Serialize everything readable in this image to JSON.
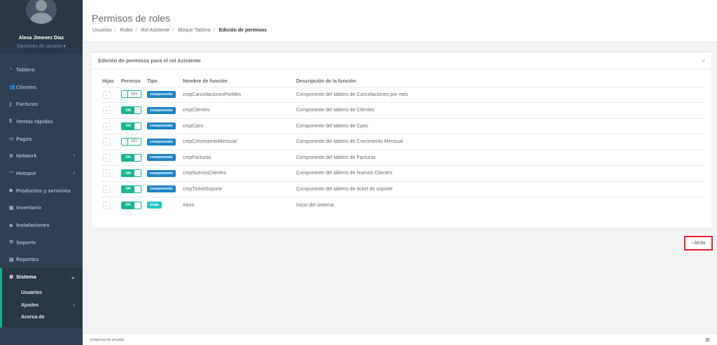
{
  "sidebar": {
    "user_name": "Alexa Jimenez Díaz",
    "user_options": "Opciones de usuario ▾",
    "items": [
      {
        "label": "Tablero",
        "icon": "gauge-icon"
      },
      {
        "label": "Clientes",
        "icon": "users-icon"
      },
      {
        "label": "Facturas",
        "icon": "file-icon"
      },
      {
        "label": "Ventas rápidas",
        "icon": "dollar-icon"
      },
      {
        "label": "Pagos",
        "icon": "money-icon"
      },
      {
        "label": "Network",
        "icon": "network-icon"
      },
      {
        "label": "Hotspot",
        "icon": "wifi-icon"
      },
      {
        "label": "Productos y servicios",
        "icon": "tag-icon"
      },
      {
        "label": "Inventario",
        "icon": "cubes-icon"
      },
      {
        "label": "Instalaciones",
        "icon": "wrench-icon"
      },
      {
        "label": "Soporte",
        "icon": "tools-icon"
      },
      {
        "label": "Reportes",
        "icon": "book-icon"
      },
      {
        "label": "Sistema",
        "icon": "cogs-icon"
      }
    ],
    "submenu": [
      {
        "label": "Usuarios"
      },
      {
        "label": "Ajustes"
      },
      {
        "label": "Acerca de"
      }
    ]
  },
  "header": {
    "title": "Permisos de roles",
    "breadcrumb": [
      "Usuarios",
      "Roles",
      "Rol Asistente",
      "Bloque Tablero"
    ],
    "breadcrumb_current": "Edición de permisos"
  },
  "panel": {
    "title": "Edición de permisos para el rol Asistente",
    "close": "×",
    "columns": [
      "Hijas",
      "Permiso",
      "Tipo",
      "Nombre de función",
      "Descripción de la función"
    ],
    "rows": [
      {
        "permiso": "OFF",
        "tipo": "componente",
        "nombre": "cmpCancelacionesPorMes",
        "descripcion": "Componente del tablero de Cancelaciones por mes"
      },
      {
        "permiso": "ON",
        "tipo": "componente",
        "nombre": "cmpClientes",
        "descripcion": "Componente del tablero de Clientes"
      },
      {
        "permiso": "ON",
        "tipo": "componente",
        "nombre": "cmpCpes",
        "descripcion": "Componente del tablero de Cpes"
      },
      {
        "permiso": "OFF",
        "tipo": "componente",
        "nombre": "cmpCrecimientoMensual",
        "descripcion": "Componente del tablero de Crecimiento Mensual"
      },
      {
        "permiso": "ON",
        "tipo": "componente",
        "nombre": "cmpFacturas",
        "descripcion": "Componente del tablero de Facturas"
      },
      {
        "permiso": "ON",
        "tipo": "componente",
        "nombre": "cmpNuevosClientes",
        "descripcion": "Componente del tablero de Nuevos Clientes"
      },
      {
        "permiso": "ON",
        "tipo": "componente",
        "nombre": "cmpTicketSoporte",
        "descripcion": "Componente del tablero de ticket de soporte"
      },
      {
        "permiso": "ON",
        "tipo": "vista",
        "nombre": "Inicio",
        "descripcion": "Inicio del sistema"
      }
    ]
  },
  "back_button": "‹ Atrás",
  "footer": {
    "text": "Empresa de prueba",
    "icon": "sitemap-icon"
  },
  "colors": {
    "sidebar": "#2f4050",
    "accent": "#1ab394",
    "badge_component": "#1c84c6",
    "badge_view": "#23c6c8",
    "highlight": "#e3262a"
  }
}
